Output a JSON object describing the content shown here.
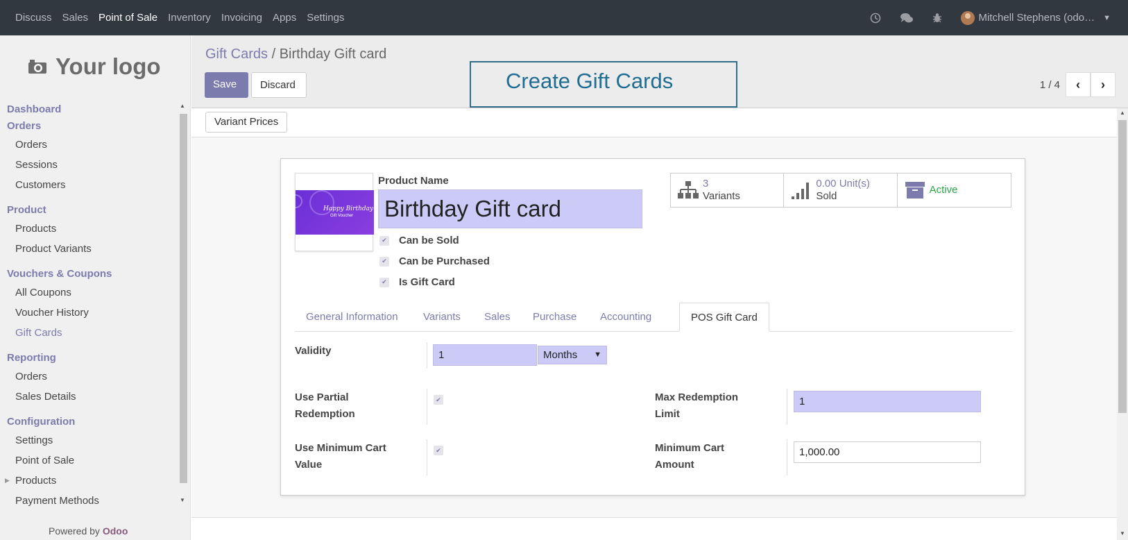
{
  "topbar": {
    "nav": [
      "Discuss",
      "Sales",
      "Point of Sale",
      "Inventory",
      "Invoicing",
      "Apps",
      "Settings"
    ],
    "active": "Point of Sale",
    "user": "Mitchell Stephens (odo…"
  },
  "sidebar": {
    "logo": "Your logo",
    "sections": [
      {
        "title": "Dashboard",
        "items": []
      },
      {
        "title": "Orders",
        "items": [
          "Orders",
          "Sessions",
          "Customers"
        ]
      },
      {
        "title": "Product",
        "items": [
          "Products",
          "Product Variants"
        ]
      },
      {
        "title": "Vouchers & Coupons",
        "items": [
          "All Coupons",
          "Voucher History",
          "Gift Cards"
        ]
      },
      {
        "title": "Reporting",
        "items": [
          "Orders",
          "Sales Details"
        ]
      },
      {
        "title": "Configuration",
        "items": [
          "Settings",
          "Point of Sale",
          "Products",
          "Payment Methods"
        ]
      }
    ],
    "active_item": "Gift Cards",
    "powered_prefix": "Powered by",
    "powered_brand": "Odoo"
  },
  "control": {
    "breadcrumb_parent": "Gift Cards",
    "breadcrumb_sep": "/",
    "breadcrumb_current": "Birthday Gift card",
    "save": "Save",
    "discard": "Discard",
    "pager": "1 / 4"
  },
  "callout": "Create Gift Cards",
  "statusbar": {
    "variant_prices": "Variant Prices"
  },
  "form": {
    "image_text1": "Happy Birthday",
    "image_text2": "Gift Voucher",
    "product_name_label": "Product Name",
    "product_name": "Birthday Gift card",
    "checks": [
      "Can be Sold",
      "Can be Purchased",
      "Is Gift Card"
    ],
    "stats": {
      "variants_num": "3",
      "variants_label": "Variants",
      "sold_num": "0.00",
      "sold_unit": "Unit(s)",
      "sold_label": "Sold",
      "active_label": "Active"
    },
    "tabs": [
      "General Information",
      "Variants",
      "Sales",
      "Purchase",
      "Accounting",
      "POS Gift Card"
    ],
    "active_tab": "POS Gift Card",
    "validity_label": "Validity",
    "validity_value": "1",
    "validity_unit": "Months",
    "partial_label_1": "Use Partial",
    "partial_label_2": "Redemption",
    "max_label_1": "Max Redemption",
    "max_label_2": "Limit",
    "max_value": "1",
    "mincart_label_1": "Use Minimum Cart",
    "mincart_label_2": "Value",
    "minamount_label_1": "Minimum Cart",
    "minamount_label_2": "Amount",
    "minamount_value": "1,000.00"
  },
  "colors": {
    "brand": "#7c7bad",
    "topbar": "#323840",
    "active_status": "#28a745",
    "callout": "#1f6d93"
  }
}
